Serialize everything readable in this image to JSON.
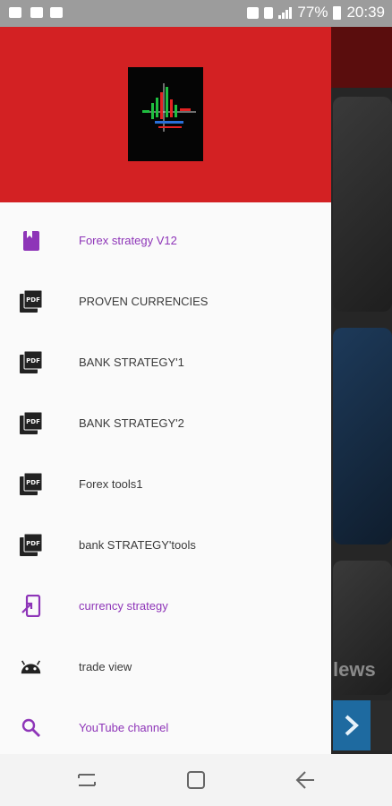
{
  "status_bar": {
    "battery": "77%",
    "time": "20:39"
  },
  "drawer": {
    "header_color": "#d32123",
    "logo": "forex-chart-logo",
    "items": [
      {
        "label": "Forex strategy V12",
        "icon": "book-icon",
        "accent": "purple"
      },
      {
        "label": "PROVEN CURRENCIES",
        "icon": "pdf-icon",
        "accent": "dark"
      },
      {
        "label": "BANK STRATEGY'1",
        "icon": "pdf-icon",
        "accent": "dark"
      },
      {
        "label": "BANK STRATEGY'2",
        "icon": "pdf-icon",
        "accent": "dark"
      },
      {
        "label": "Forex tools1",
        "icon": "pdf-icon",
        "accent": "dark"
      },
      {
        "label": "bank STRATEGY'tools",
        "icon": "pdf-icon",
        "accent": "dark"
      },
      {
        "label": "currency strategy",
        "icon": "open-app-icon",
        "accent": "purple"
      },
      {
        "label": "trade view",
        "icon": "android-icon",
        "accent": "dark"
      },
      {
        "label": "YouTube channel",
        "icon": "search-icon",
        "accent": "purple"
      }
    ]
  },
  "background": {
    "news_text": "lews"
  },
  "colors": {
    "accent_purple": "#8e35b8",
    "header_red": "#d32123"
  }
}
